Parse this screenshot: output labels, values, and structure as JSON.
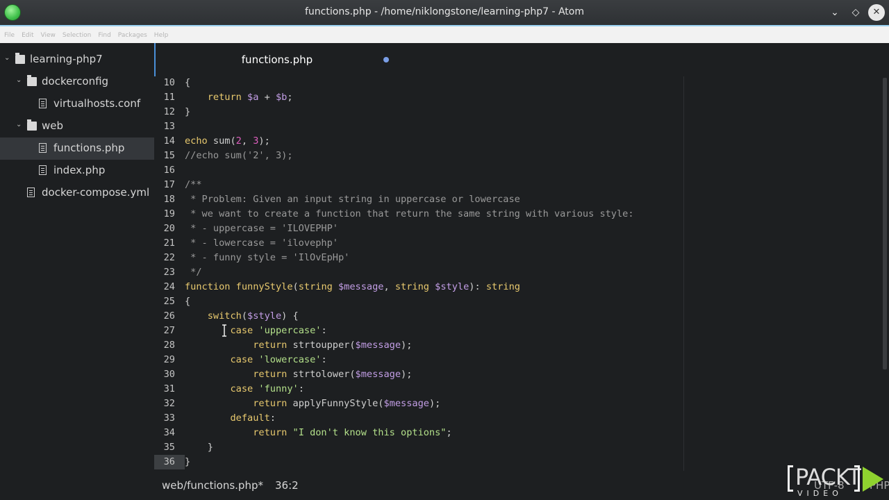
{
  "window": {
    "title": "functions.php - /home/niklongstone/learning-php7 - Atom",
    "min_glyph": "⌄",
    "max_glyph": "◇",
    "close_glyph": "✕"
  },
  "menu": [
    "File",
    "Edit",
    "View",
    "Selection",
    "Find",
    "Packages",
    "Help"
  ],
  "tree": {
    "items": [
      {
        "label": "learning-php7",
        "type": "folder",
        "expanded": true,
        "depth": 0
      },
      {
        "label": "dockerconfig",
        "type": "folder",
        "expanded": true,
        "depth": 1
      },
      {
        "label": "virtualhosts.conf",
        "type": "file",
        "depth": 2
      },
      {
        "label": "web",
        "type": "folder",
        "expanded": true,
        "depth": 1
      },
      {
        "label": "functions.php",
        "type": "file",
        "depth": 2,
        "selected": true
      },
      {
        "label": "index.php",
        "type": "file",
        "depth": 2
      },
      {
        "label": "docker-compose.yml",
        "type": "file",
        "depth": 1
      }
    ]
  },
  "tab": {
    "label": "functions.php",
    "modified": true
  },
  "editor": {
    "active_line": 36,
    "lines": [
      {
        "n": "10",
        "tokens": [
          [
            "pl",
            "{"
          ]
        ]
      },
      {
        "n": "11",
        "tokens": [
          [
            "pl",
            "    "
          ],
          [
            "kw",
            "return"
          ],
          [
            "pl",
            " "
          ],
          [
            "var",
            "$a"
          ],
          [
            "pl",
            " + "
          ],
          [
            "var",
            "$b"
          ],
          [
            "pl",
            ";"
          ]
        ]
      },
      {
        "n": "12",
        "tokens": [
          [
            "pl",
            "}"
          ]
        ]
      },
      {
        "n": "13",
        "tokens": []
      },
      {
        "n": "14",
        "tokens": [
          [
            "kw",
            "echo"
          ],
          [
            "pl",
            " sum("
          ],
          [
            "num",
            "2"
          ],
          [
            "pl",
            ", "
          ],
          [
            "num",
            "3"
          ],
          [
            "pl",
            ");"
          ]
        ]
      },
      {
        "n": "15",
        "tokens": [
          [
            "cmt",
            "//echo sum('2', 3);"
          ]
        ]
      },
      {
        "n": "16",
        "tokens": []
      },
      {
        "n": "17",
        "tokens": [
          [
            "cmt",
            "/**"
          ]
        ]
      },
      {
        "n": "18",
        "tokens": [
          [
            "cmt",
            " * Problem: Given an input string in uppercase or lowercase"
          ]
        ]
      },
      {
        "n": "19",
        "tokens": [
          [
            "cmt",
            " * we want to create a function that return the same string with various style:"
          ]
        ]
      },
      {
        "n": "20",
        "tokens": [
          [
            "cmt",
            " * - uppercase = 'ILOVEPHP'"
          ]
        ]
      },
      {
        "n": "21",
        "tokens": [
          [
            "cmt",
            " * - lowercase = 'ilovephp'"
          ]
        ]
      },
      {
        "n": "22",
        "tokens": [
          [
            "cmt",
            " * - funny style = 'IlOvEpHp'"
          ]
        ]
      },
      {
        "n": "23",
        "tokens": [
          [
            "cmt",
            " */"
          ]
        ]
      },
      {
        "n": "24",
        "tokens": [
          [
            "kw",
            "function"
          ],
          [
            "pl",
            " "
          ],
          [
            "fn",
            "funnyStyle"
          ],
          [
            "pl",
            "("
          ],
          [
            "kw",
            "string"
          ],
          [
            "pl",
            " "
          ],
          [
            "var",
            "$message"
          ],
          [
            "pl",
            ", "
          ],
          [
            "kw",
            "string"
          ],
          [
            "pl",
            " "
          ],
          [
            "var",
            "$style"
          ],
          [
            "pl",
            "): "
          ],
          [
            "kw",
            "string"
          ]
        ]
      },
      {
        "n": "25",
        "tokens": [
          [
            "pl",
            "{"
          ]
        ]
      },
      {
        "n": "26",
        "tokens": [
          [
            "pl",
            "    "
          ],
          [
            "kw",
            "switch"
          ],
          [
            "pl",
            "("
          ],
          [
            "var",
            "$style"
          ],
          [
            "pl",
            ") {"
          ]
        ]
      },
      {
        "n": "27",
        "tokens": [
          [
            "pl",
            "        "
          ],
          [
            "kw",
            "case"
          ],
          [
            "pl",
            " "
          ],
          [
            "str",
            "'uppercase'"
          ],
          [
            "pl",
            ":"
          ]
        ]
      },
      {
        "n": "28",
        "tokens": [
          [
            "pl",
            "            "
          ],
          [
            "kw",
            "return"
          ],
          [
            "pl",
            " strtoupper("
          ],
          [
            "var",
            "$message"
          ],
          [
            "pl",
            ");"
          ]
        ]
      },
      {
        "n": "29",
        "tokens": [
          [
            "pl",
            "        "
          ],
          [
            "kw",
            "case"
          ],
          [
            "pl",
            " "
          ],
          [
            "str",
            "'lowercase'"
          ],
          [
            "pl",
            ":"
          ]
        ]
      },
      {
        "n": "30",
        "tokens": [
          [
            "pl",
            "            "
          ],
          [
            "kw",
            "return"
          ],
          [
            "pl",
            " strtolower("
          ],
          [
            "var",
            "$message"
          ],
          [
            "pl",
            ");"
          ]
        ]
      },
      {
        "n": "31",
        "tokens": [
          [
            "pl",
            "        "
          ],
          [
            "kw",
            "case"
          ],
          [
            "pl",
            " "
          ],
          [
            "str",
            "'funny'"
          ],
          [
            "pl",
            ":"
          ]
        ]
      },
      {
        "n": "32",
        "tokens": [
          [
            "pl",
            "            "
          ],
          [
            "kw",
            "return"
          ],
          [
            "pl",
            " applyFunnyStyle("
          ],
          [
            "var",
            "$message"
          ],
          [
            "pl",
            ");"
          ]
        ]
      },
      {
        "n": "33",
        "tokens": [
          [
            "pl",
            "        "
          ],
          [
            "kw",
            "default"
          ],
          [
            "pl",
            ":"
          ]
        ]
      },
      {
        "n": "34",
        "tokens": [
          [
            "pl",
            "            "
          ],
          [
            "kw",
            "return"
          ],
          [
            "pl",
            " "
          ],
          [
            "str",
            "\"I don't know this options\""
          ],
          [
            "pl",
            ";"
          ]
        ]
      },
      {
        "n": "35",
        "tokens": [
          [
            "pl",
            "    }"
          ]
        ]
      },
      {
        "n": "36",
        "tokens": [
          [
            "pl",
            "}"
          ]
        ]
      }
    ]
  },
  "status": {
    "path": "web/functions.php*",
    "position": "36:2",
    "encoding": "UTF-8",
    "grammar": "PHP"
  },
  "watermark": {
    "word": "PACKT",
    "sub": "VIDEO"
  }
}
